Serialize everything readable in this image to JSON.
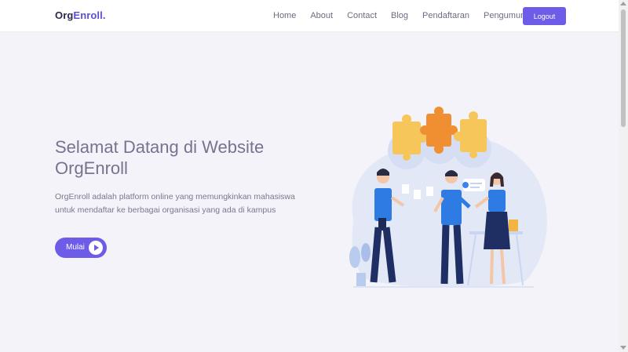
{
  "navbar": {
    "brand_part1": "Org",
    "brand_part2": "Enroll.",
    "links": [
      "Home",
      "About",
      "Contact",
      "Blog",
      "Pendaftaran",
      "Pengumuman"
    ],
    "logout_label": "Logout"
  },
  "hero": {
    "title_line1": "Selamat Datang di Website",
    "title_line2": "OrgEnroll",
    "description": "OrgEnroll adalah platform online yang memungkinkan mahasiswa untuk mendaftar ke berbagai organisasi yang ada di kampus",
    "button_label": "Mulai",
    "button_icon": "play-icon"
  },
  "colors": {
    "accent": "#6c5ce7",
    "brand_dark": "#2a2750",
    "background": "#f4f3f9"
  }
}
